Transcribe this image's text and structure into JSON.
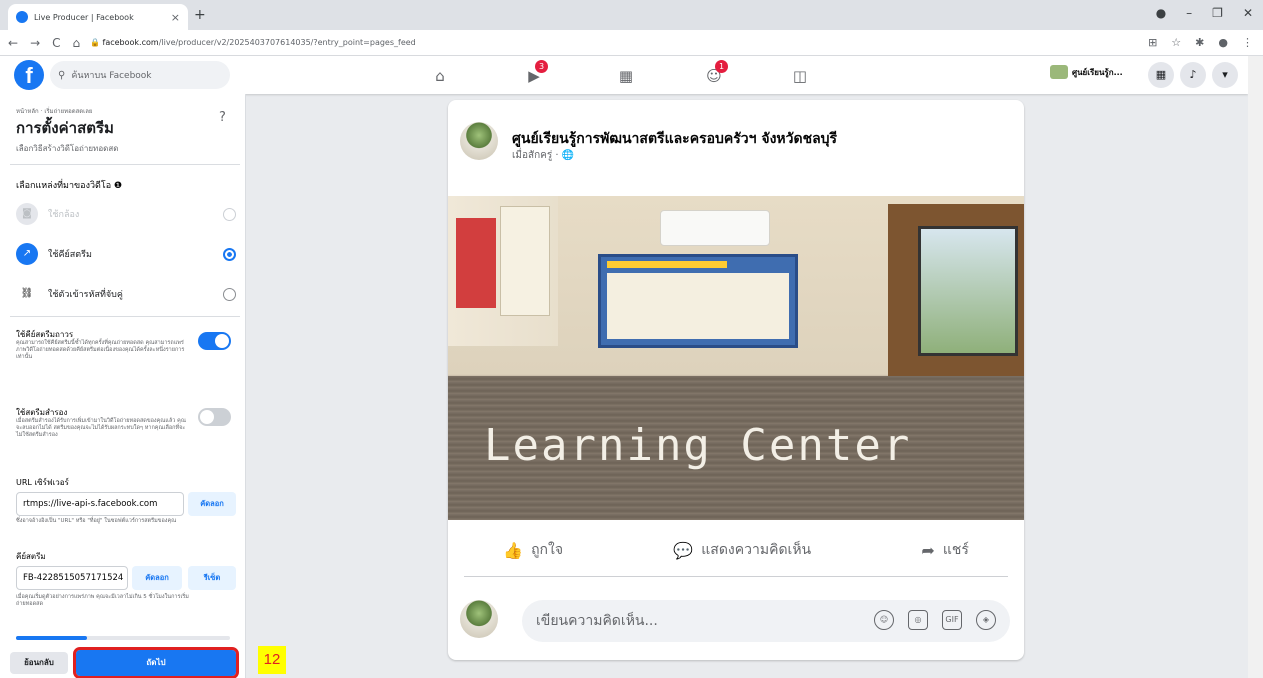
{
  "browser": {
    "tab_title": "Live Producer | Facebook",
    "tab_close": "×",
    "new_tab": "+",
    "url_host": "facebook.com",
    "url_path": "/live/producer/v2/2025403707614035/?entry_point=pages_feed"
  },
  "fb_header": {
    "logo": "f",
    "search_placeholder": "ค้นหาบน Facebook",
    "nav": [
      {
        "icon": "home-icon",
        "glyph": "⌂",
        "badge": ""
      },
      {
        "icon": "watch-icon",
        "glyph": "▶",
        "badge": "3"
      },
      {
        "icon": "marketplace-icon",
        "glyph": "▦",
        "badge": ""
      },
      {
        "icon": "groups-icon",
        "glyph": "☺",
        "badge": "1"
      },
      {
        "icon": "gaming-icon",
        "glyph": "◫",
        "badge": ""
      }
    ],
    "profile_name": "ศูนย์เรียนรู้ก...",
    "colors": {
      "brand": "#1877f2",
      "badge": "#e41e3f"
    }
  },
  "left_panel": {
    "breadcrumb": "หน้าหลัก · เริ่มถ่ายทอดสดเลย",
    "title": "การตั้งค่าสตรีม",
    "help": "?",
    "subtitle": "เลือกวิธีสร้างวิดีโอถ่ายทอดสด",
    "source_title": "เลือกแหล่งที่มาของวิดีโอ ❶",
    "options": [
      {
        "label": "ใช้กล้อง",
        "icon": "camera-icon",
        "selected": false,
        "disabled": true
      },
      {
        "label": "ใช้คีย์สตรีม",
        "icon": "stream-key-icon",
        "selected": true,
        "disabled": false
      },
      {
        "label": "ใช้ตัวเข้ารหัสที่จับคู่",
        "icon": "link-icon",
        "selected": false,
        "disabled": false
      }
    ],
    "persistent_key": {
      "title": "ใช้คีย์สตรีมถาวร",
      "desc": "คุณสามารถใช้คีย์สตรีมนี้ซ้ำได้ทุกครั้งที่คุณถ่ายทอดสด คุณสามารถแพร่ภาพวิดีโอถ่ายทอดสดด้วยคีย์สตรีมต่อเนื่องของคุณได้ครั้งละหนึ่งรายการเท่านั้น",
      "on": true
    },
    "backup_stream": {
      "title": "ใช้สตรีมสำรอง",
      "desc": "เมื่อสตรีมสำรองได้รับการเพิ่มเข้ามาในวิดีโอถ่ายทอดสดของคุณแล้ว คุณจะลบออกไม่ได้ สตรีมของคุณจะไม่ได้รับผลกระทบใดๆ หากคุณเลือกที่จะไม่ใช้สตรีมสำรอง",
      "on": false
    },
    "server_url": {
      "label": "URL เซิร์ฟเวอร์",
      "value": "rtmps://live-api-s.facebook.com",
      "copy": "คัดลอก",
      "hint": "ซึ่งอาจอ้างอิงเป็น \"URL\" หรือ \"ที่อยู่\" ในซอฟต์แวร์การสตรีมของคุณ"
    },
    "stream_key": {
      "label": "คีย์สตรีม",
      "value": "FB-4228515057171524",
      "copy": "คัดลอก",
      "reset": "รีเซ็ต",
      "hint": "เมื่อคุณเริ่มดูตัวอย่างการแพร่ภาพ คุณจะมีเวลาไม่เกิน 5 ชั่วโมงในการเริ่มถ่ายทอดสด"
    },
    "progress": 0.33,
    "back": "ย้อนกลับ",
    "next": "ถัดไป"
  },
  "step_marker": "12",
  "post": {
    "page_name": "ศูนย์เรียนรู้การพัฒนาสตรีและครอบครัวฯ จังหวัดชลบุรี",
    "meta": "เมื่อสักครู่ · 🌐",
    "photo_text": "Learning  Center",
    "like": "ถูกใจ",
    "comment": "แสดงความคิดเห็น",
    "share": "แชร์",
    "comment_placeholder": "เขียนความคิดเห็น...",
    "comment_icons": [
      "☺",
      "◎",
      "GIF",
      "◈"
    ]
  }
}
